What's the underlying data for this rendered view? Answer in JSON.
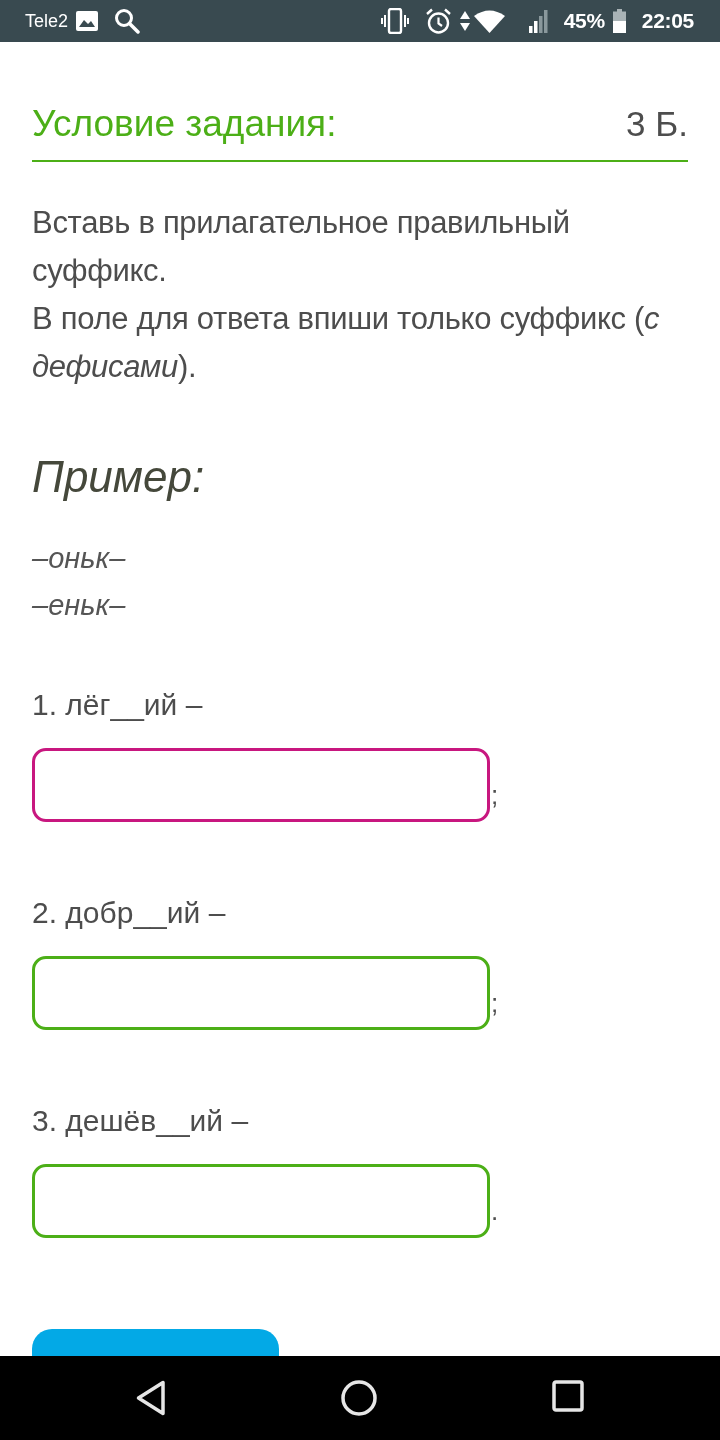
{
  "status_bar": {
    "carrier": "Tele2",
    "battery": "45%",
    "time": "22:05"
  },
  "task": {
    "title": "Условие задания:",
    "points": "3 Б.",
    "instructions": [
      "Вставь в прилагательное правильный суффикс.",
      "В поле для ответа впиши только суффикс (*с дефисами*)."
    ]
  },
  "example": {
    "heading": "Пример:",
    "lines": [
      "–оньк–",
      "–еньк–"
    ]
  },
  "questions": [
    {
      "prompt": "1. лёг__ий –",
      "focused": true,
      "punctuation": ";"
    },
    {
      "prompt": "2. добр__ий –",
      "focused": false,
      "punctuation": ";"
    },
    {
      "prompt": "3. дешёв__ий –",
      "focused": false,
      "punctuation": "."
    }
  ]
}
